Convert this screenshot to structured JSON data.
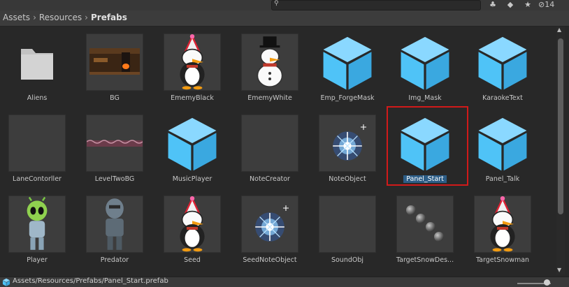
{
  "toolbar": {
    "hidden_count": "14"
  },
  "breadcrumb": {
    "parts": [
      "Assets",
      "Resources"
    ],
    "current": "Prefabs"
  },
  "assets": [
    {
      "name": "Aliens"
    },
    {
      "name": "BG"
    },
    {
      "name": "EmemyBlack"
    },
    {
      "name": "EmemyWhite"
    },
    {
      "name": "Emp_ForgeMask"
    },
    {
      "name": "Img_Mask"
    },
    {
      "name": "KaraokeText"
    },
    {
      "name": "LaneContorller"
    },
    {
      "name": "LevelTwoBG"
    },
    {
      "name": "MusicPlayer"
    },
    {
      "name": "NoteCreator"
    },
    {
      "name": "NoteObject"
    },
    {
      "name": "Panel_Start"
    },
    {
      "name": "Panel_Talk"
    },
    {
      "name": "Player"
    },
    {
      "name": "Predator"
    },
    {
      "name": "Seed"
    },
    {
      "name": "SeedNoteObject"
    },
    {
      "name": "SoundObj"
    },
    {
      "name": "TargetSnowDes..."
    },
    {
      "name": "TargetSnowman"
    }
  ],
  "status": {
    "path": "Assets/Resources/Prefabs/Panel_Start.prefab"
  },
  "colors": {
    "prefab_blue": "#4fc3f7",
    "selection_blue": "#2c5d87",
    "highlight_red": "#d11a1a"
  }
}
